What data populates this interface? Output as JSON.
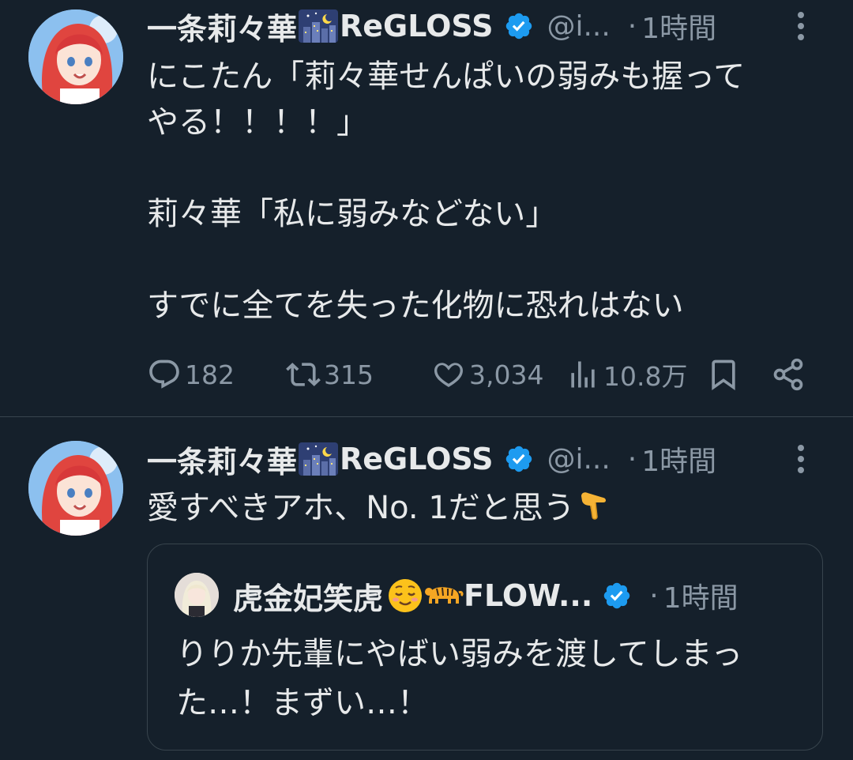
{
  "colors": {
    "background": "#15202b",
    "text": "#e7e9ea",
    "secondary": "#8b98a5",
    "verified": "#1d9bf0",
    "divider": "#38444d"
  },
  "tweets": [
    {
      "author_name": "一条莉々華",
      "author_name_suffix": "ReGLOSS",
      "handle": "@i...",
      "separator": "·",
      "time": "1時間",
      "text": "にこたん「莉々華せんぱいの弱みも握って\nやる！！！！」\n\n莉々華「私に弱みなどない」\n\nすでに全てを失った化物に恐れはない",
      "replies": "182",
      "reposts": "315",
      "likes": "3,034",
      "views": "10.8万"
    },
    {
      "author_name": "一条莉々華",
      "author_name_suffix": "ReGLOSS",
      "handle": "@i...",
      "separator": "·",
      "time": "1時間",
      "text": "愛すべきアホ、No. 1だと思う",
      "quote": {
        "author_name": "虎金妃笑虎",
        "author_name_suffix": "FLOW...",
        "separator": "·",
        "time": "1時間",
        "text": "りりか先輩にやばい弱みを渡してしまっ\nた…！まずい…！"
      }
    }
  ],
  "icons": [
    "avatar",
    "city-night-emoji",
    "verified-badge-icon",
    "more-icon",
    "reply-icon",
    "repost-icon",
    "like-icon",
    "views-icon",
    "bookmark-icon",
    "share-icon",
    "relieved-face-emoji",
    "tiger-emoji",
    "backhand-index-pointing-down-emoji"
  ]
}
